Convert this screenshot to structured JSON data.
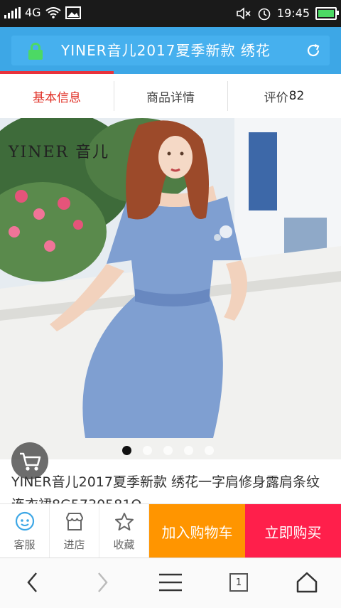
{
  "status_bar": {
    "network": "4G",
    "time": "19:45"
  },
  "browser": {
    "url_title": "YINER音儿2017夏季新款 绣花"
  },
  "tabs": [
    {
      "label": "基本信息",
      "active": true
    },
    {
      "label": "商品详情",
      "active": false
    },
    {
      "label": "评价",
      "count": "82",
      "active": false
    }
  ],
  "product": {
    "brand_logo": "YINER 音儿",
    "image_dots": {
      "total": 5,
      "active": 0
    },
    "title": "YINER音儿2017夏季新款 绣花一字肩修身露肩条纹连衣裙8G5730581O"
  },
  "actions": {
    "service_label": "客服",
    "store_label": "进店",
    "favorite_label": "收藏",
    "add_cart_label": "加入购物车",
    "buy_now_label": "立即购买"
  },
  "nav": {
    "tab_count": "1"
  },
  "colors": {
    "urlbar": "#3da7e6",
    "active_tab": "#e02e24",
    "add_cart": "#ff9500",
    "buy_now": "#ff1f4b",
    "accent": "#3da7e6"
  }
}
